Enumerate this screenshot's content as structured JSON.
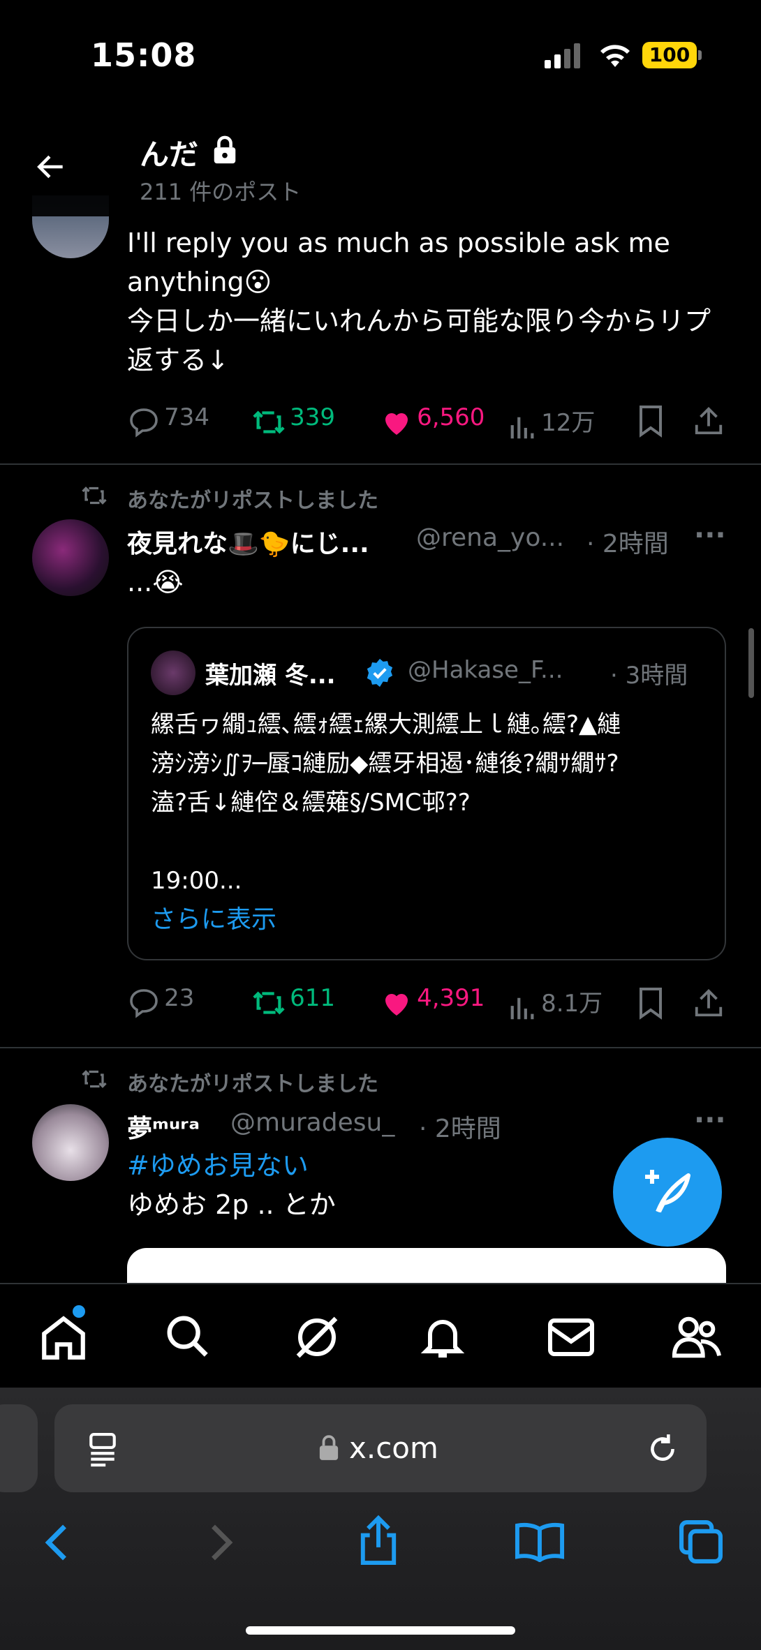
{
  "status": {
    "time": "15:08",
    "battery": "100"
  },
  "header": {
    "name": "んだ",
    "post_count": "211 件のポスト"
  },
  "tweets": [
    {
      "text_lines": [
        "I'll reply you as much as possible ask me",
        "anything😮",
        "今日しか一緒にいれんから可能な限り今からリプ",
        "返する↓"
      ],
      "replies": "734",
      "reposts": "339",
      "likes": "6,560",
      "views": "12万"
    },
    {
      "repost_label": "あなたがリポストしました",
      "display_name": "夜見れな🎩🐤にじ...",
      "handle": "@rena_yo...",
      "time": "· 2時間",
      "text": "...😭",
      "quote": {
        "display_name": "葉加瀬 冬...",
        "handle": "@Hakase_F...",
        "time": "· 3時間",
        "text_lines": [
          "縲舌ヮ繝ｭ繧､繧ｫ繧ｪ縲大測繧上ｌ縺｡繧?▲縺",
          "滂ｼ滂ｼ∬ｦ─蜃ｺ縺励◆繧牙相遏･縺後?繝ｻ繝ｻ?",
          "溘?舌↓縺倥＆繧薙§/SMC邨??"
        ],
        "time_line": "19:00...",
        "show_more": "さらに表示"
      },
      "replies": "23",
      "reposts": "611",
      "likes": "4,391",
      "views": "8.1万"
    },
    {
      "repost_label": "あなたがリポストしました",
      "display_name": "夢ᵐᵘʳᵃ",
      "handle": "@muradesu_",
      "time": "· 2時間",
      "hashtag": "#ゆめお見ない",
      "text": "ゆめお 2p .. とか"
    }
  ],
  "browser": {
    "url": "x.com"
  },
  "colors": {
    "accent": "#1d9bf0",
    "repost": "#00ba7c",
    "like": "#f91880",
    "muted": "#71767b",
    "battery": "#ffd60a"
  }
}
